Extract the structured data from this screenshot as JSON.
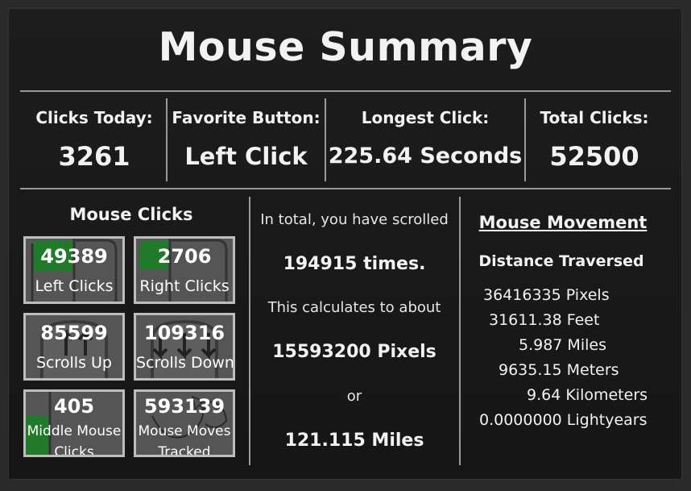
{
  "title": "Mouse Summary",
  "stats": {
    "clicks_today": {
      "label": "Clicks Today:",
      "value": "3261"
    },
    "favorite_button": {
      "label": "Favorite Button:",
      "value": "Left Click"
    },
    "longest_click": {
      "label": "Longest Click:",
      "value": "225.64 Seconds"
    },
    "total_clicks": {
      "label": "Total Clicks:",
      "value": "52500"
    }
  },
  "mouse_clicks": {
    "title": "Mouse Clicks",
    "tiles": [
      {
        "value": "49389",
        "label": "Left Clicks"
      },
      {
        "value": "2706",
        "label": "Right Clicks"
      },
      {
        "value": "85599",
        "label": "Scrolls Up"
      },
      {
        "value": "109316",
        "label": "Scrolls Down"
      },
      {
        "value": "405",
        "label_line1": "Middle Mouse",
        "label_line2": "Clicks"
      },
      {
        "value": "593139",
        "label_line1": "Mouse Moves",
        "label_line2": "Tracked"
      }
    ]
  },
  "scrolling": {
    "intro": "In total, you have scrolled",
    "times": "194915 times.",
    "calc": "This calculates to about",
    "pixels": "15593200 Pixels",
    "or": "or",
    "miles": "121.115 Miles"
  },
  "movement": {
    "title": "Mouse Movement",
    "subtitle": "Distance Traversed",
    "distances": [
      "36416335 Pixels",
      "31611.38 Feet",
      "5.987 Miles",
      "9635.15 Meters",
      "9.64 Kilometers",
      "0.0000000 Lightyears"
    ]
  },
  "colors": {
    "highlight_green": "#1f7a2a",
    "tile_gray": "#555555",
    "border": "#bdbdbd"
  }
}
